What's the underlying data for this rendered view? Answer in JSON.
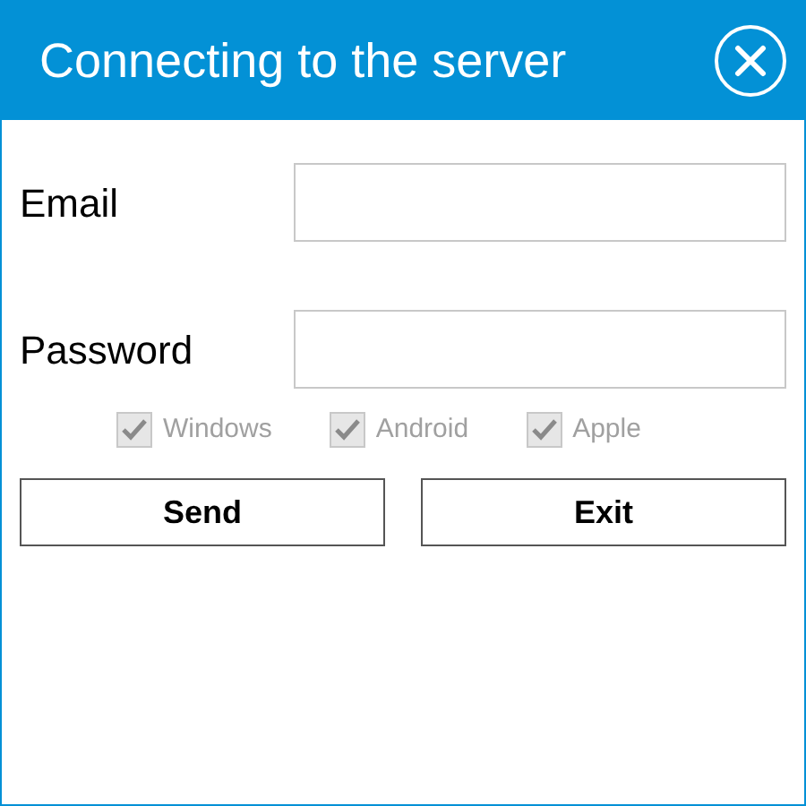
{
  "window": {
    "title": "Connecting to the server"
  },
  "fields": [
    {
      "label": "Email"
    },
    {
      "label": "Password"
    }
  ],
  "options": [
    {
      "label": "Windows",
      "checked": true,
      "disabled": true
    },
    {
      "label": "Android",
      "checked": true,
      "disabled": true
    },
    {
      "label": "Apple",
      "checked": true,
      "disabled": true
    }
  ],
  "buttons": [
    "Send",
    "Exit"
  ]
}
